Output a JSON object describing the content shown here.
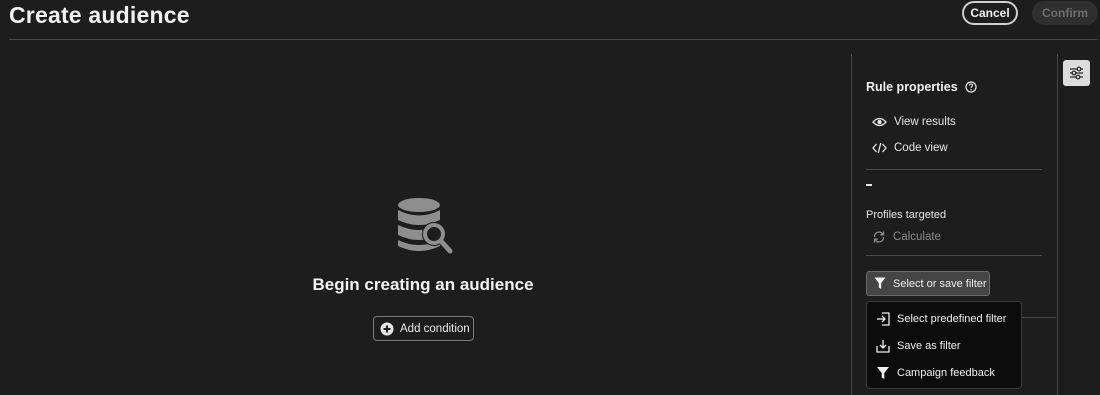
{
  "header": {
    "title": "Create audience",
    "cancel_label": "Cancel",
    "confirm_label": "Confirm"
  },
  "empty_state": {
    "icon": "database-search-icon",
    "title": "Begin creating an audience",
    "add_condition_label": "Add condition"
  },
  "rule_panel": {
    "title": "Rule properties",
    "view_results_label": "View results",
    "code_view_label": "Code view",
    "profiles_value": "-",
    "profiles_label": "Profiles targeted",
    "calculate_label": "Calculate",
    "filter_button_label": "Select or save filter"
  },
  "filter_menu": {
    "items": [
      {
        "label": "Select predefined filter",
        "icon": "import-icon"
      },
      {
        "label": "Save as filter",
        "icon": "download-icon"
      },
      {
        "label": "Campaign feedback",
        "icon": "filter-icon"
      }
    ]
  },
  "colors": {
    "background": "#1d1d1d",
    "text": "#e6e6e6",
    "divider": "#4a4a4a",
    "disabled": "#6e6e6e",
    "menu_bg": "#0c0c0c"
  }
}
